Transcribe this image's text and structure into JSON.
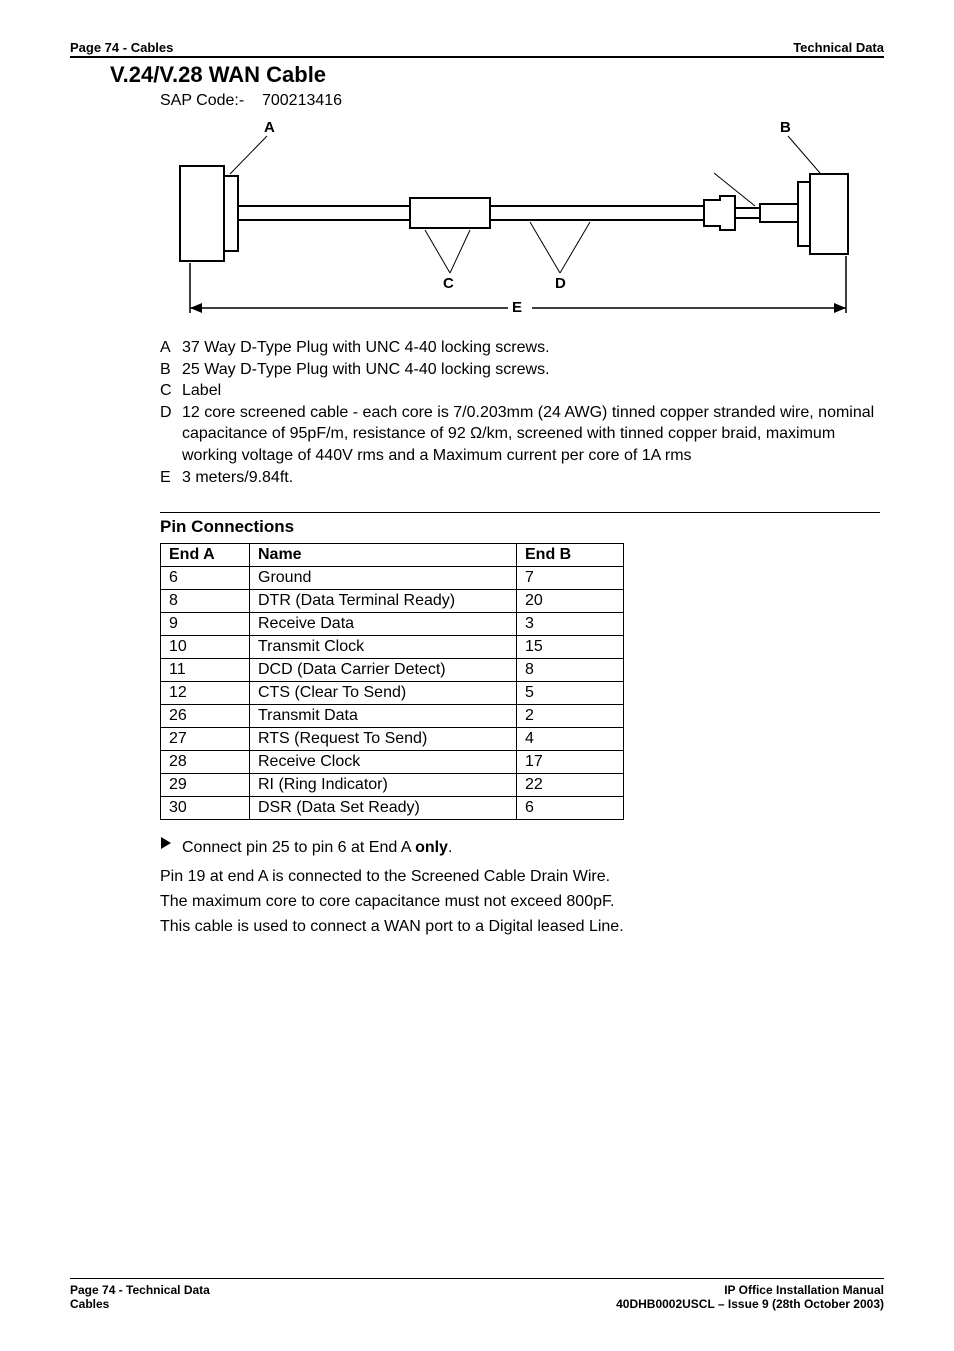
{
  "header": {
    "left": "Page 74 - Cables",
    "right": "Technical Data"
  },
  "title": "V.24/V.28 WAN Cable",
  "sap_label": "SAP Code:-",
  "sap_value": "700213416",
  "diagram": {
    "A": "A",
    "B": "B",
    "C": "C",
    "D": "D",
    "E": "E"
  },
  "legend": {
    "A": {
      "letter": "A",
      "text": "37 Way D-Type Plug with UNC 4-40 locking screws."
    },
    "B": {
      "letter": "B",
      "text": "25 Way D-Type Plug with UNC 4-40 locking screws."
    },
    "C": {
      "letter": "C",
      "text": "Label"
    },
    "D": {
      "letter": "D",
      "text": "12 core screened cable - each core is 7/0.203mm (24 AWG) tinned copper stranded wire, nominal capacitance of 95pF/m, resistance of 92 Ω/km, screened with tinned copper braid, maximum working voltage of 440V rms and a Maximum current per core of 1A rms"
    },
    "E": {
      "letter": "E",
      "text": "3 meters/9.84ft."
    }
  },
  "pin_heading": "Pin Connections",
  "pin_table": {
    "headers": {
      "a": "End A",
      "name": "Name",
      "b": "End B"
    },
    "rows": [
      {
        "a": "6",
        "name": "Ground",
        "b": "7"
      },
      {
        "a": "8",
        "name": "DTR (Data Terminal Ready)",
        "b": "20"
      },
      {
        "a": "9",
        "name": "Receive Data",
        "b": "3"
      },
      {
        "a": "10",
        "name": "Transmit Clock",
        "b": "15"
      },
      {
        "a": "11",
        "name": "DCD (Data Carrier Detect)",
        "b": "8"
      },
      {
        "a": "12",
        "name": "CTS (Clear To Send)",
        "b": "5"
      },
      {
        "a": "26",
        "name": "Transmit Data",
        "b": "2"
      },
      {
        "a": "27",
        "name": "RTS (Request To Send)",
        "b": "4"
      },
      {
        "a": "28",
        "name": "Receive Clock",
        "b": "17"
      },
      {
        "a": "29",
        "name": "RI (Ring Indicator)",
        "b": "22"
      },
      {
        "a": "30",
        "name": "DSR (Data Set Ready)",
        "b": "6"
      }
    ]
  },
  "notes": {
    "bullet_pre": "Connect pin 25 to pin 6 at End A ",
    "bullet_bold": "only",
    "bullet_post": ".",
    "l2": "Pin 19 at end A is connected to the Screened Cable Drain Wire.",
    "l3": "The maximum core to core capacitance must not exceed 800pF.",
    "l4": "This cable is used to connect a WAN port to a Digital leased Line."
  },
  "footer": {
    "left1": "Page 74 - Technical Data",
    "left2": "Cables",
    "right1": "IP Office Installation Manual",
    "right2": "40DHB0002USCL – Issue 9 (28th October 2003)"
  }
}
